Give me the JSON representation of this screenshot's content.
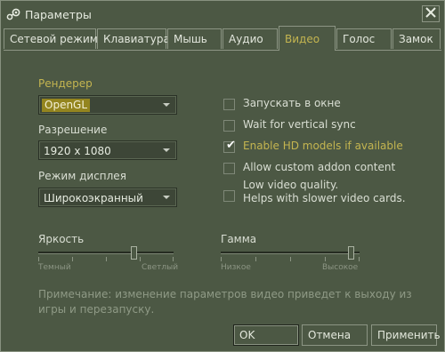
{
  "window": {
    "title": "Параметры",
    "icon": "steam-icon",
    "close_icon": "close-icon"
  },
  "tabs": [
    {
      "label": "Сетевой режим",
      "active": false
    },
    {
      "label": "Клавиатура",
      "active": false
    },
    {
      "label": "Мышь",
      "active": false
    },
    {
      "label": "Аудио",
      "active": false
    },
    {
      "label": "Видео",
      "active": true
    },
    {
      "label": "Голос",
      "active": false
    },
    {
      "label": "Замок",
      "active": false
    }
  ],
  "video": {
    "renderer": {
      "label": "Рендерер",
      "value": "OpenGL"
    },
    "resolution": {
      "label": "Разрешение",
      "value": "1920 x 1080"
    },
    "display_mode": {
      "label": "Режим дисплея",
      "value": "Широкоэкранный"
    },
    "options": [
      {
        "label": "Запускать в окне",
        "checked": false
      },
      {
        "label": "Wait for vertical sync",
        "checked": false
      },
      {
        "label": "Enable HD models if available",
        "checked": true
      },
      {
        "label": "Allow custom addon content",
        "checked": false
      },
      {
        "label_line1": "Low video quality.",
        "label_line2": "Helps with slower video cards.",
        "checked": false
      }
    ],
    "brightness": {
      "label": "Яркость",
      "min_label": "Темный",
      "max_label": "Светлый",
      "level": 0.72
    },
    "gamma": {
      "label": "Гамма",
      "min_label": "Низкое",
      "max_label": "Высокое",
      "level": 0.96
    },
    "note": "Примечание: изменение параметров видео приведет к выходу из игры и перезапуску."
  },
  "buttons": {
    "ok": "OK",
    "cancel": "Отмена",
    "apply": "Применить"
  },
  "colors": {
    "background": "#4c5844",
    "accent": "#c4b550",
    "selection": "#94851f"
  }
}
